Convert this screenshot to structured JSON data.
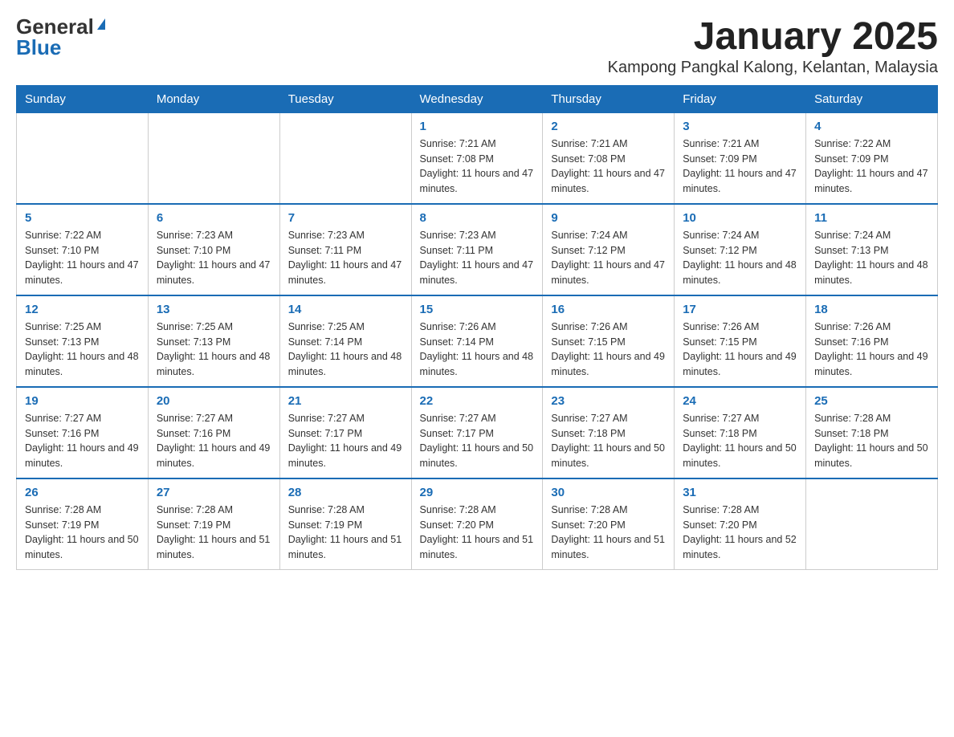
{
  "header": {
    "logo_general": "General",
    "logo_blue": "Blue",
    "month_title": "January 2025",
    "location": "Kampong Pangkal Kalong, Kelantan, Malaysia"
  },
  "days_of_week": [
    "Sunday",
    "Monday",
    "Tuesday",
    "Wednesday",
    "Thursday",
    "Friday",
    "Saturday"
  ],
  "weeks": [
    {
      "days": [
        {
          "number": "",
          "info": ""
        },
        {
          "number": "",
          "info": ""
        },
        {
          "number": "",
          "info": ""
        },
        {
          "number": "1",
          "info": "Sunrise: 7:21 AM\nSunset: 7:08 PM\nDaylight: 11 hours and 47 minutes."
        },
        {
          "number": "2",
          "info": "Sunrise: 7:21 AM\nSunset: 7:08 PM\nDaylight: 11 hours and 47 minutes."
        },
        {
          "number": "3",
          "info": "Sunrise: 7:21 AM\nSunset: 7:09 PM\nDaylight: 11 hours and 47 minutes."
        },
        {
          "number": "4",
          "info": "Sunrise: 7:22 AM\nSunset: 7:09 PM\nDaylight: 11 hours and 47 minutes."
        }
      ]
    },
    {
      "days": [
        {
          "number": "5",
          "info": "Sunrise: 7:22 AM\nSunset: 7:10 PM\nDaylight: 11 hours and 47 minutes."
        },
        {
          "number": "6",
          "info": "Sunrise: 7:23 AM\nSunset: 7:10 PM\nDaylight: 11 hours and 47 minutes."
        },
        {
          "number": "7",
          "info": "Sunrise: 7:23 AM\nSunset: 7:11 PM\nDaylight: 11 hours and 47 minutes."
        },
        {
          "number": "8",
          "info": "Sunrise: 7:23 AM\nSunset: 7:11 PM\nDaylight: 11 hours and 47 minutes."
        },
        {
          "number": "9",
          "info": "Sunrise: 7:24 AM\nSunset: 7:12 PM\nDaylight: 11 hours and 47 minutes."
        },
        {
          "number": "10",
          "info": "Sunrise: 7:24 AM\nSunset: 7:12 PM\nDaylight: 11 hours and 48 minutes."
        },
        {
          "number": "11",
          "info": "Sunrise: 7:24 AM\nSunset: 7:13 PM\nDaylight: 11 hours and 48 minutes."
        }
      ]
    },
    {
      "days": [
        {
          "number": "12",
          "info": "Sunrise: 7:25 AM\nSunset: 7:13 PM\nDaylight: 11 hours and 48 minutes."
        },
        {
          "number": "13",
          "info": "Sunrise: 7:25 AM\nSunset: 7:13 PM\nDaylight: 11 hours and 48 minutes."
        },
        {
          "number": "14",
          "info": "Sunrise: 7:25 AM\nSunset: 7:14 PM\nDaylight: 11 hours and 48 minutes."
        },
        {
          "number": "15",
          "info": "Sunrise: 7:26 AM\nSunset: 7:14 PM\nDaylight: 11 hours and 48 minutes."
        },
        {
          "number": "16",
          "info": "Sunrise: 7:26 AM\nSunset: 7:15 PM\nDaylight: 11 hours and 49 minutes."
        },
        {
          "number": "17",
          "info": "Sunrise: 7:26 AM\nSunset: 7:15 PM\nDaylight: 11 hours and 49 minutes."
        },
        {
          "number": "18",
          "info": "Sunrise: 7:26 AM\nSunset: 7:16 PM\nDaylight: 11 hours and 49 minutes."
        }
      ]
    },
    {
      "days": [
        {
          "number": "19",
          "info": "Sunrise: 7:27 AM\nSunset: 7:16 PM\nDaylight: 11 hours and 49 minutes."
        },
        {
          "number": "20",
          "info": "Sunrise: 7:27 AM\nSunset: 7:16 PM\nDaylight: 11 hours and 49 minutes."
        },
        {
          "number": "21",
          "info": "Sunrise: 7:27 AM\nSunset: 7:17 PM\nDaylight: 11 hours and 49 minutes."
        },
        {
          "number": "22",
          "info": "Sunrise: 7:27 AM\nSunset: 7:17 PM\nDaylight: 11 hours and 50 minutes."
        },
        {
          "number": "23",
          "info": "Sunrise: 7:27 AM\nSunset: 7:18 PM\nDaylight: 11 hours and 50 minutes."
        },
        {
          "number": "24",
          "info": "Sunrise: 7:27 AM\nSunset: 7:18 PM\nDaylight: 11 hours and 50 minutes."
        },
        {
          "number": "25",
          "info": "Sunrise: 7:28 AM\nSunset: 7:18 PM\nDaylight: 11 hours and 50 minutes."
        }
      ]
    },
    {
      "days": [
        {
          "number": "26",
          "info": "Sunrise: 7:28 AM\nSunset: 7:19 PM\nDaylight: 11 hours and 50 minutes."
        },
        {
          "number": "27",
          "info": "Sunrise: 7:28 AM\nSunset: 7:19 PM\nDaylight: 11 hours and 51 minutes."
        },
        {
          "number": "28",
          "info": "Sunrise: 7:28 AM\nSunset: 7:19 PM\nDaylight: 11 hours and 51 minutes."
        },
        {
          "number": "29",
          "info": "Sunrise: 7:28 AM\nSunset: 7:20 PM\nDaylight: 11 hours and 51 minutes."
        },
        {
          "number": "30",
          "info": "Sunrise: 7:28 AM\nSunset: 7:20 PM\nDaylight: 11 hours and 51 minutes."
        },
        {
          "number": "31",
          "info": "Sunrise: 7:28 AM\nSunset: 7:20 PM\nDaylight: 11 hours and 52 minutes."
        },
        {
          "number": "",
          "info": ""
        }
      ]
    }
  ]
}
